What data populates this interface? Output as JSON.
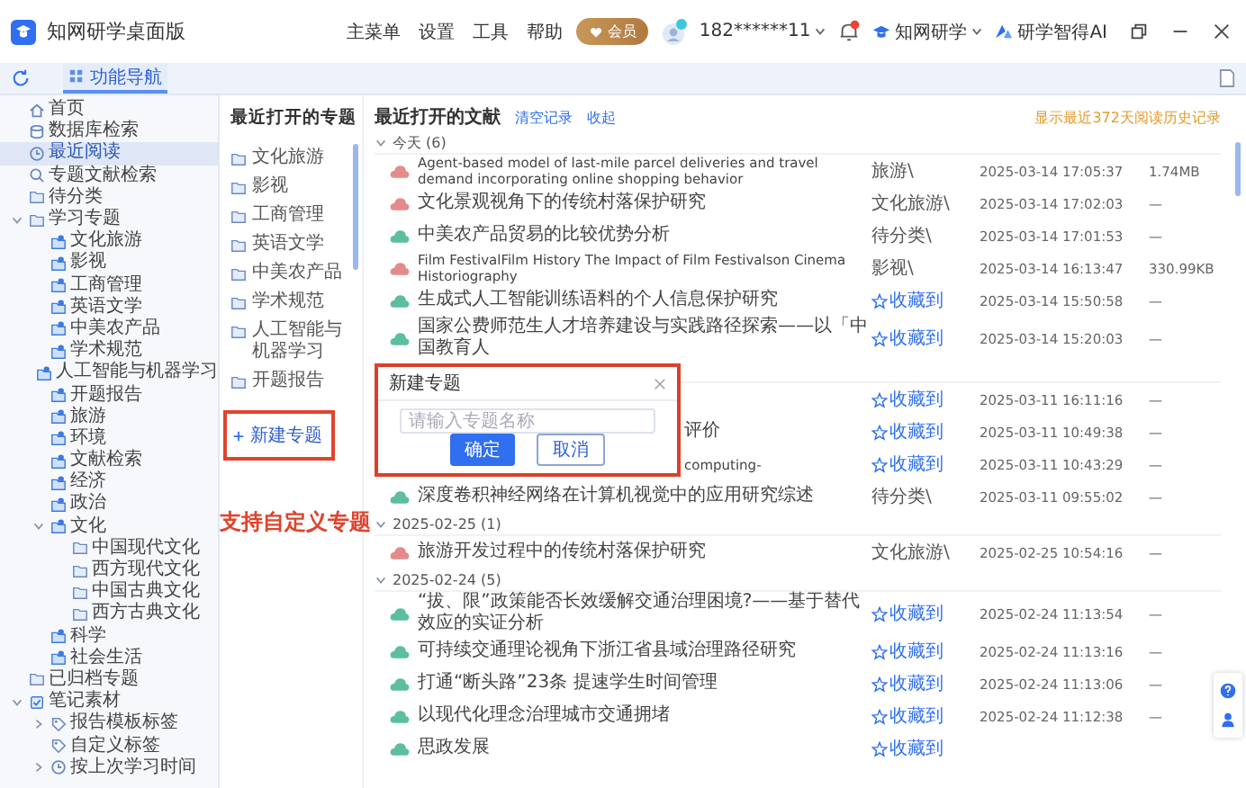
{
  "window": {
    "title": "知网研学桌面版"
  },
  "menu": [
    {
      "label": "主菜单"
    },
    {
      "label": "设置"
    },
    {
      "label": "工具"
    },
    {
      "label": "帮助"
    }
  ],
  "member_badge": {
    "label": "会员"
  },
  "user": {
    "name": "182******11"
  },
  "notifications": {
    "unread": true
  },
  "switches": [
    {
      "label": "知网研学",
      "kind": "cap"
    },
    {
      "label": "研学智得AI",
      "kind": "ai"
    }
  ],
  "tabs": [
    {
      "label": "功能导航",
      "selected": true
    }
  ],
  "sidebar": {
    "items": [
      {
        "label": "首页",
        "kind": "home",
        "selected": false
      },
      {
        "label": "数据库检索",
        "kind": "database",
        "selected": false
      },
      {
        "label": "最近阅读",
        "kind": "recent",
        "selected": true
      },
      {
        "label": "专题文献检索",
        "kind": "search",
        "selected": false
      },
      {
        "label": "待分类",
        "kind": "folder",
        "selected": false
      },
      {
        "label": "学习专题",
        "kind": "folder",
        "selected": false,
        "expanded": true,
        "children": [
          {
            "label": "文化旅游",
            "kind": "topic",
            "selected": false
          },
          {
            "label": "影视",
            "kind": "topic",
            "selected": false
          },
          {
            "label": "工商管理",
            "kind": "topic",
            "selected": false
          },
          {
            "label": "英语文学",
            "kind": "topic",
            "selected": false
          },
          {
            "label": "中美农产品",
            "kind": "topic",
            "selected": false
          },
          {
            "label": "学术规范",
            "kind": "topic",
            "selected": false
          },
          {
            "label": "人工智能与机器学习",
            "kind": "topic",
            "selected": false
          },
          {
            "label": "开题报告",
            "kind": "topic",
            "selected": false
          },
          {
            "label": "旅游",
            "kind": "topic",
            "selected": false
          },
          {
            "label": "环境",
            "kind": "topic",
            "selected": false
          },
          {
            "label": "文献检索",
            "kind": "topic",
            "selected": false
          },
          {
            "label": "经济",
            "kind": "topic",
            "selected": false
          },
          {
            "label": "政治",
            "kind": "topic",
            "selected": false
          },
          {
            "label": "文化",
            "kind": "topic",
            "selected": false,
            "expanded": true,
            "children": [
              {
                "label": "中国现代文化",
                "kind": "folder",
                "selected": false
              },
              {
                "label": "西方现代文化",
                "kind": "folder",
                "selected": false
              },
              {
                "label": "中国古典文化",
                "kind": "folder",
                "selected": false
              },
              {
                "label": "西方古典文化",
                "kind": "folder",
                "selected": false
              }
            ]
          },
          {
            "label": "科学",
            "kind": "topic",
            "selected": false
          },
          {
            "label": "社会生活",
            "kind": "topic",
            "selected": false
          }
        ]
      },
      {
        "label": "已归档专题",
        "kind": "folder",
        "selected": false
      },
      {
        "label": "笔记素材",
        "kind": "notes",
        "selected": false,
        "expanded": true,
        "children": [
          {
            "label": "报告模板标签",
            "kind": "tag",
            "selected": false,
            "expanded": false
          },
          {
            "label": "自定义标签",
            "kind": "tag",
            "selected": false
          },
          {
            "label": "按上次学习时间",
            "kind": "time",
            "selected": false,
            "expanded": false
          }
        ]
      }
    ]
  },
  "topics_panel": {
    "title": "最近打开的专题",
    "items": [
      "文化旅游",
      "影视",
      "工商管理",
      "英语文学",
      "中美农产品",
      "学术规范",
      "人工智能与机器学习",
      "开题报告"
    ],
    "new_button": "新建专题"
  },
  "annotation": {
    "text": "支持自定义专题"
  },
  "documents": {
    "title": "最近打开的文献",
    "actions": [
      "清空记录",
      "收起"
    ],
    "note": "显示最近372天阅读历史记录",
    "groups": [
      {
        "label": "今天 (6)",
        "rows": [
          {
            "kind": "doc",
            "title": "Agent-based model of last-mile parcel deliveries and travel demand incorporating online shopping behavior",
            "color": "#e58a8a",
            "category": "旅游\\",
            "date": "2025-03-14 17:05:37",
            "size": "1.74MB"
          },
          {
            "kind": "doc",
            "title": "文化景观视角下的传统村落保护研究",
            "color": "#e58a8a",
            "category": "文化旅游\\",
            "date": "2025-03-14 17:02:03",
            "size": "—"
          },
          {
            "kind": "doc",
            "title": "中美农产品贸易的比较优势分析",
            "color": "#5bbf9f",
            "category": "待分类\\",
            "date": "2025-03-14 17:01:53",
            "size": "—"
          },
          {
            "kind": "doc",
            "title": "Film FestivalFilm History The Impact of Film Festivalson Cinema Historiography",
            "color": "#e58a8a",
            "category": "影视\\",
            "date": "2025-03-14 16:13:47",
            "size": "330.99KB"
          },
          {
            "kind": "doc",
            "title": "生成式人工智能训练语料的个人信息保护研究",
            "color": "#5bbf9f",
            "collect": "收藏到",
            "date": "2025-03-14 15:50:58",
            "size": "—"
          },
          {
            "kind": "doc",
            "title": "国家公费师范生人才培养建设与实践路径探索——以「中国教育人",
            "color": "#5bbf9f",
            "collect": "收藏到",
            "date": "2025-03-14 15:20:03",
            "size": "—"
          }
        ]
      },
      {
        "rows": [
          {
            "kind": "covered",
            "collect": "收藏到",
            "date": "2025-03-11 16:11:16",
            "size": "—"
          },
          {
            "kind": "covered",
            "title": "评价",
            "collect": "收藏到",
            "date": "2025-03-11 10:49:38",
            "size": "—"
          },
          {
            "kind": "covered",
            "title": "computing-",
            "collect": "收藏到",
            "date": "2025-03-11 10:43:29",
            "size": "—"
          },
          {
            "kind": "doc",
            "title": "深度卷积神经网络在计算机视觉中的应用研究综述",
            "color": "#5bbf9f",
            "category": "待分类\\",
            "date": "2025-03-11 09:55:02",
            "size": "—"
          }
        ]
      },
      {
        "label": "2025-02-25 (1)",
        "rows": [
          {
            "kind": "doc",
            "title": "旅游开发过程中的传统村落保护研究",
            "color": "#e58a8a",
            "category": "文化旅游\\",
            "date": "2025-02-25 10:54:16",
            "size": "—"
          }
        ]
      },
      {
        "label": "2025-02-24 (5)",
        "rows": [
          {
            "kind": "doc",
            "title": "“拔、限”政策能否长效缓解交通治理困境?——基于替代效应的实证分析",
            "color": "#5bbf9f",
            "collect": "收藏到",
            "date": "2025-02-24 11:13:54",
            "size": "—"
          },
          {
            "kind": "doc",
            "title": "可持续交通理论视角下浙江省县域治理路径研究",
            "color": "#5bbf9f",
            "collect": "收藏到",
            "date": "2025-02-24 11:13:16",
            "size": "—"
          },
          {
            "kind": "doc",
            "title": "打通“断头路”23条 提速学生时间管理",
            "color": "#5bbf9f",
            "collect": "收藏到",
            "date": "2025-02-24 11:13:06",
            "size": "—"
          },
          {
            "kind": "doc",
            "title": "以现代化理念治理城市交通拥堵",
            "color": "#5bbf9f",
            "collect": "收藏到",
            "date": "2025-02-24 11:12:38",
            "size": "—"
          },
          {
            "kind": "doc",
            "title": "思政发展",
            "color": "#5bbf9f",
            "collect": "收藏到"
          }
        ]
      }
    ]
  },
  "dialog": {
    "title": "新建专题",
    "placeholder": "请输入专题名称",
    "buttons": [
      {
        "label": "确定",
        "kind": "primary"
      },
      {
        "label": "取消",
        "kind": "secondary"
      }
    ]
  }
}
